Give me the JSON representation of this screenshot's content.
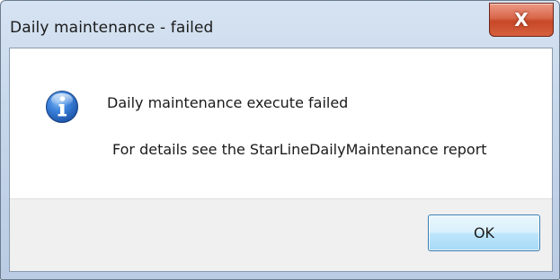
{
  "window": {
    "title": "Daily maintenance - failed",
    "close_icon": "close-icon",
    "close_glyph": "X"
  },
  "message": {
    "icon": "information-icon",
    "main_text": "Daily maintenance execute failed",
    "detail_text": "For details see the StarLineDailyMaintenance report"
  },
  "buttons": {
    "ok_label": "OK"
  },
  "colors": {
    "close_button": "#c64826",
    "ok_button_border": "#3c7fb1",
    "info_icon_blue": "#1f5fb8",
    "footer_background": "#f0f0f0"
  }
}
